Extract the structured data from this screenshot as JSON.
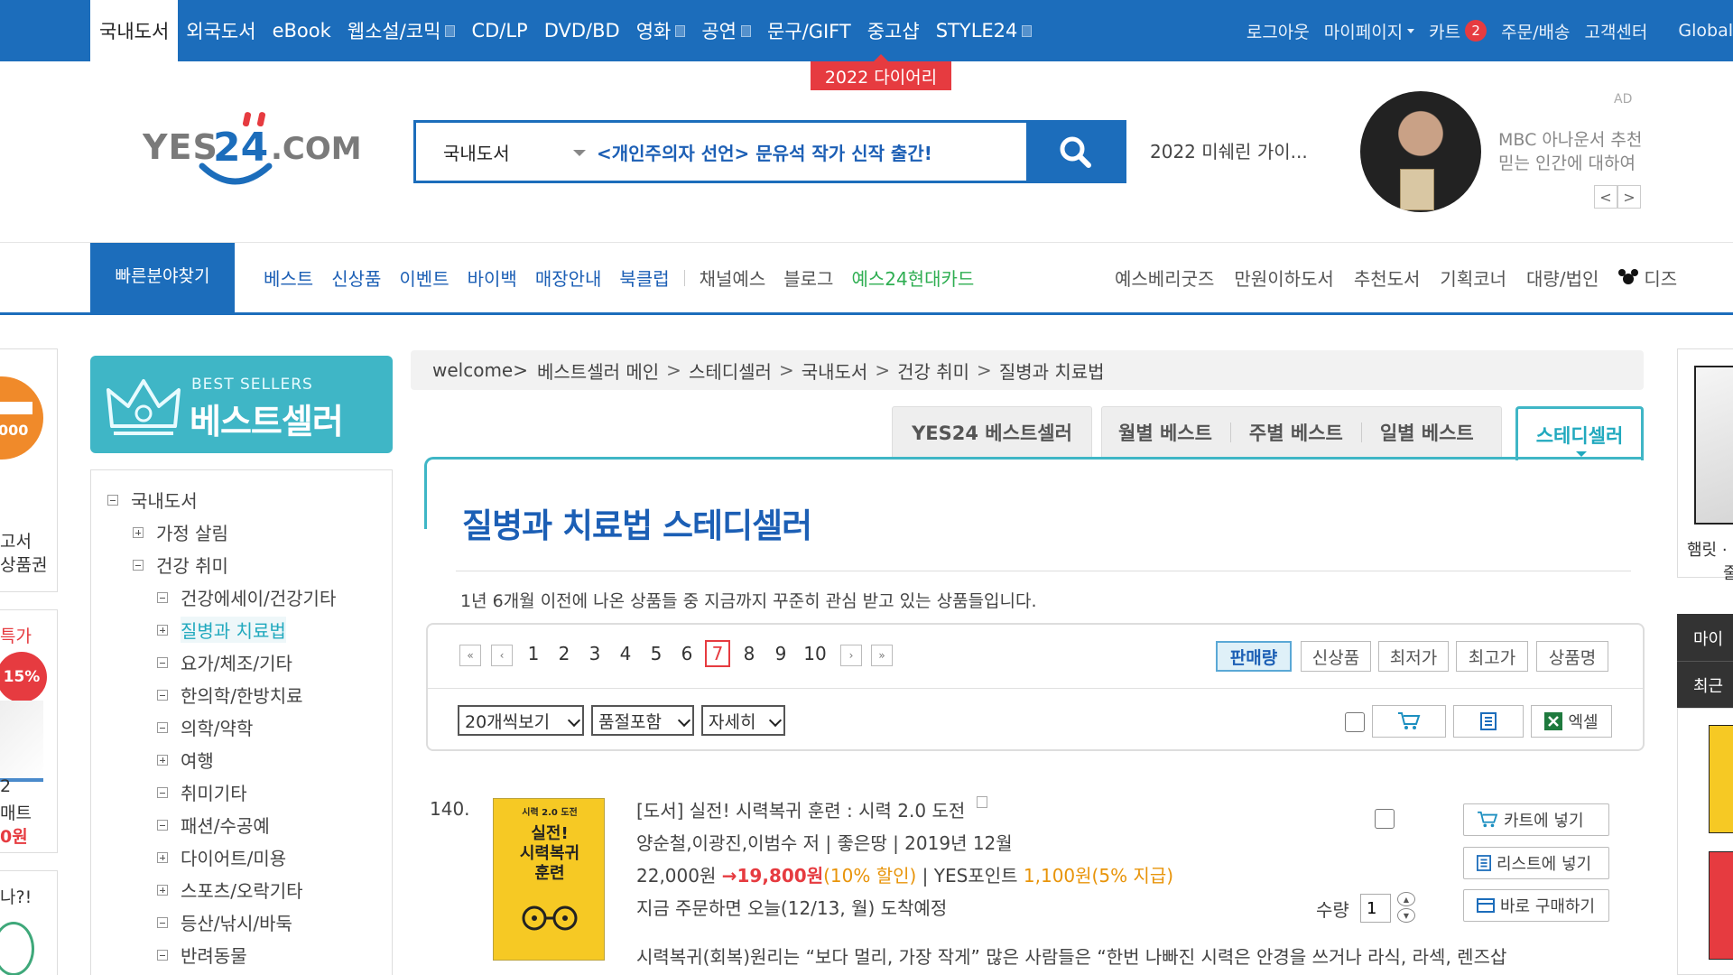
{
  "top_nav": {
    "items": [
      {
        "label": "국내도서",
        "active": true,
        "square": false
      },
      {
        "label": "외국도서",
        "active": false,
        "square": false
      },
      {
        "label": "eBook",
        "active": false,
        "square": false
      },
      {
        "label": "웹소설/코믹",
        "active": false,
        "square": true
      },
      {
        "label": "CD/LP",
        "active": false,
        "square": false
      },
      {
        "label": "DVD/BD",
        "active": false,
        "square": false
      },
      {
        "label": "영화",
        "active": false,
        "square": true
      },
      {
        "label": "공연",
        "active": false,
        "square": true
      },
      {
        "label": "문구/GIFT",
        "active": false,
        "square": false
      },
      {
        "label": "중고샵",
        "active": false,
        "square": false
      },
      {
        "label": "STYLE24",
        "active": false,
        "square": true
      }
    ],
    "right": {
      "logout": "로그아웃",
      "mypage": "마이페이지",
      "cart": "카트",
      "cart_count": "2",
      "orders": "주문/배송",
      "support": "고객센터",
      "global": "Global"
    },
    "promo_banner": "2022 다이어리"
  },
  "logo": {
    "text": "YES24.COM"
  },
  "search": {
    "category": "국내도서",
    "value": "<개인주의자 선언> 문유석 작가 신작 출간!",
    "side_text": "2022 미쉐린 가이..."
  },
  "ad": {
    "label": "AD",
    "line1": "MBC 아나운서 추천",
    "line2": "믿는 인간에 대하여",
    "prev": "<",
    "next": ">"
  },
  "category_nav": {
    "quick_find": "빠른분야찾기",
    "items": [
      "베스트",
      "신상품",
      "이벤트",
      "바이백",
      "매장안내",
      "북클럽"
    ],
    "gray_items": [
      "채널예스",
      "블로그"
    ],
    "card": "예스24현대카드",
    "right_items": [
      "예스베리굿즈",
      "만원이하도서",
      "추천도서",
      "기획코너",
      "대량/법인"
    ],
    "disney": "디즈"
  },
  "left_ads": {
    "ad1_line1": "고서",
    "ad1_line2": "상품권",
    "ad1_price": "000",
    "ad2_top": "특가",
    "ad2_badge": "15%",
    "ad2_line1": "2",
    "ad2_line2": "매트",
    "ad2_line3": "0원",
    "ad3_text": "나?!"
  },
  "bestseller_banner": {
    "small": "BEST SELLERS",
    "big": "베스트셀러"
  },
  "tree": [
    {
      "label": "국내도서",
      "level": 0,
      "box": "minus"
    },
    {
      "label": "가정 살림",
      "level": 1,
      "box": "plus"
    },
    {
      "label": "건강 취미",
      "level": 1,
      "box": "minus"
    },
    {
      "label": "건강에세이/건강기타",
      "level": 2,
      "box": "minus"
    },
    {
      "label": "질병과 치료법",
      "level": 2,
      "box": "plus",
      "active": true
    },
    {
      "label": "요가/체조/기타",
      "level": 2,
      "box": "minus"
    },
    {
      "label": "한의학/한방치료",
      "level": 2,
      "box": "minus"
    },
    {
      "label": "의학/약학",
      "level": 2,
      "box": "minus"
    },
    {
      "label": "여행",
      "level": 2,
      "box": "plus"
    },
    {
      "label": "취미기타",
      "level": 2,
      "box": "minus"
    },
    {
      "label": "패션/수공예",
      "level": 2,
      "box": "minus"
    },
    {
      "label": "다이어트/미용",
      "level": 2,
      "box": "plus"
    },
    {
      "label": "스포츠/오락기타",
      "level": 2,
      "box": "plus"
    },
    {
      "label": "등산/낚시/바둑",
      "level": 2,
      "box": "minus"
    },
    {
      "label": "반려동물",
      "level": 2,
      "box": "minus"
    }
  ],
  "breadcrumb": {
    "welcome": "welcome>",
    "items": [
      "베스트셀러 메인",
      "스테디셀러",
      "국내도서",
      "건강 취미",
      "질병과 치료법"
    ],
    "sep": ">"
  },
  "tabs": {
    "yes24": "YES24 베스트셀러",
    "monthly": "월별 베스트",
    "weekly": "주별 베스트",
    "daily": "일별 베스트",
    "steady": "스테디셀러"
  },
  "panel": {
    "title": "질병과 치료법 스테디셀러",
    "desc": "1년 6개월 이전에 나온 상품들 중 지금까지 꾸준히 관심 받고 있는 상품들입니다."
  },
  "pager": {
    "pages": [
      "1",
      "2",
      "3",
      "4",
      "5",
      "6",
      "7",
      "8",
      "9",
      "10"
    ],
    "current": "7"
  },
  "sort": {
    "options": [
      "판매량",
      "신상품",
      "최저가",
      "최고가",
      "상품명"
    ],
    "active": "판매량"
  },
  "view_options": {
    "per_page": "20개씩보기",
    "soldout": "품절포함",
    "detail": "자세히",
    "excel": "엑셀"
  },
  "product": {
    "rank": "140.",
    "cover_line1": "시력 2.0 도전",
    "cover_line2": "실전!",
    "cover_line3": "시력복귀",
    "cover_line4": "훈련",
    "title": "[도서] 실전! 시력복귀 훈련 : 시력 2.0 도전",
    "author_line": "양순철,이광진,이범수 저 | 좋은땅 | 2019년 12월",
    "price_original": "22,000원",
    "arrow": "→",
    "price_sale": "19,800원",
    "discount": "(10% 할인)",
    "points_label": "| YES포인트",
    "points": "1,100원",
    "points_rate": "(5% 지급)",
    "delivery": "지금 주문하면 오늘(12/13, 월) 도착예정",
    "summary": "시력복귀(회복)원리는 “보다 멀리, 가장 작게” 많은 사람들은 “한번 나빠진 시력은 안경을 쓰거나 라식, 라섹, 렌즈삽",
    "qty_label": "수량",
    "qty_value": "1",
    "cart_btn": "카트에 넣기",
    "list_btn": "리스트에 넣기",
    "buy_btn": "바로 구매하기"
  },
  "right_strip": {
    "caption1": "햄릿 ·",
    "caption2": "줄",
    "my": "마이",
    "recent": "최근"
  }
}
